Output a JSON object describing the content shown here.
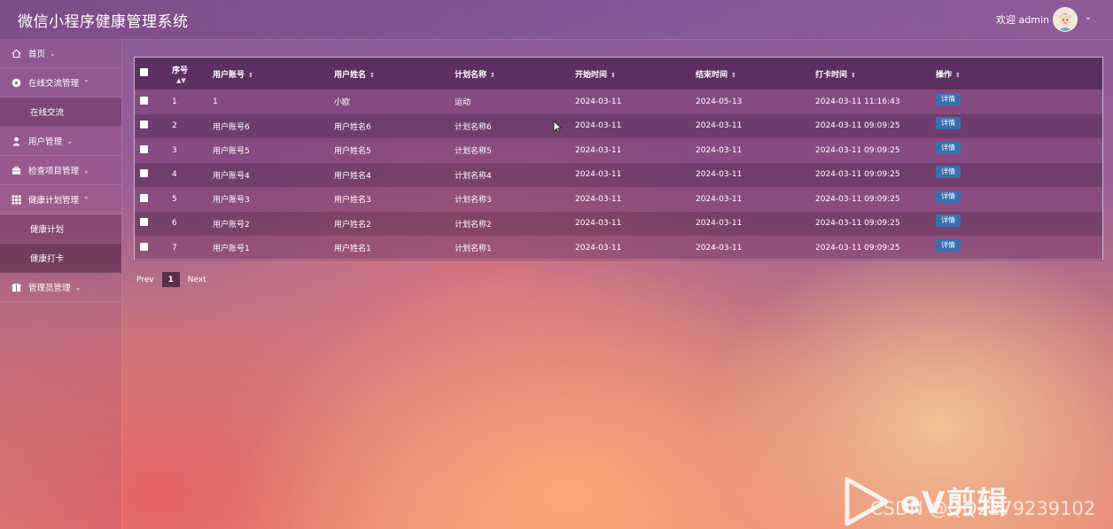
{
  "app": {
    "title": "微信小程序健康管理系统"
  },
  "header": {
    "welcome": "欢迎 admin"
  },
  "sidebar": {
    "items": [
      {
        "label": "首页",
        "icon": "home-icon",
        "expanded": false,
        "children": []
      },
      {
        "label": "在线交流管理",
        "icon": "chat-icon",
        "expanded": true,
        "children": [
          {
            "label": "在线交流",
            "active": false
          }
        ]
      },
      {
        "label": "用户管理",
        "icon": "user-icon",
        "expanded": false,
        "children": []
      },
      {
        "label": "检查项目管理",
        "icon": "briefcase-icon",
        "expanded": false,
        "children": []
      },
      {
        "label": "健康计划管理",
        "icon": "grid-icon",
        "expanded": true,
        "children": [
          {
            "label": "健康计划",
            "active": false
          },
          {
            "label": "健康打卡",
            "active": true
          }
        ]
      },
      {
        "label": "管理员管理",
        "icon": "gift-icon",
        "expanded": false,
        "children": []
      }
    ]
  },
  "table": {
    "columns": [
      "序号",
      "用户账号",
      "用户姓名",
      "计划名称",
      "开始时间",
      "结束时间",
      "打卡时间",
      "操作"
    ],
    "rows": [
      [
        "1",
        "1",
        "小欧",
        "运动",
        "2024-03-11",
        "2024-05-13",
        "2024-03-11 11:16:43"
      ],
      [
        "2",
        "用户账号6",
        "用户姓名6",
        "计划名称6",
        "2024-03-11",
        "2024-03-11",
        "2024-03-11 09:09:25"
      ],
      [
        "3",
        "用户账号5",
        "用户姓名5",
        "计划名称5",
        "2024-03-11",
        "2024-03-11",
        "2024-03-11 09:09:25"
      ],
      [
        "4",
        "用户账号4",
        "用户姓名4",
        "计划名称4",
        "2024-03-11",
        "2024-03-11",
        "2024-03-11 09:09:25"
      ],
      [
        "5",
        "用户账号3",
        "用户姓名3",
        "计划名称3",
        "2024-03-11",
        "2024-03-11",
        "2024-03-11 09:09:25"
      ],
      [
        "6",
        "用户账号2",
        "用户姓名2",
        "计划名称2",
        "2024-03-11",
        "2024-03-11",
        "2024-03-11 09:09:25"
      ],
      [
        "7",
        "用户账号1",
        "用户姓名1",
        "计划名称1",
        "2024-03-11",
        "2024-03-11",
        "2024-03-11 09:09:25"
      ]
    ],
    "action_label": "详情"
  },
  "pagination": {
    "prev": "Prev",
    "current": "1",
    "next": "Next"
  },
  "watermark": {
    "brand": "eV剪辑",
    "csdn": "CSDN @QQ2279239102"
  },
  "colors": {
    "detail_button": "#3a6fb0",
    "header_row": "#46204b"
  }
}
